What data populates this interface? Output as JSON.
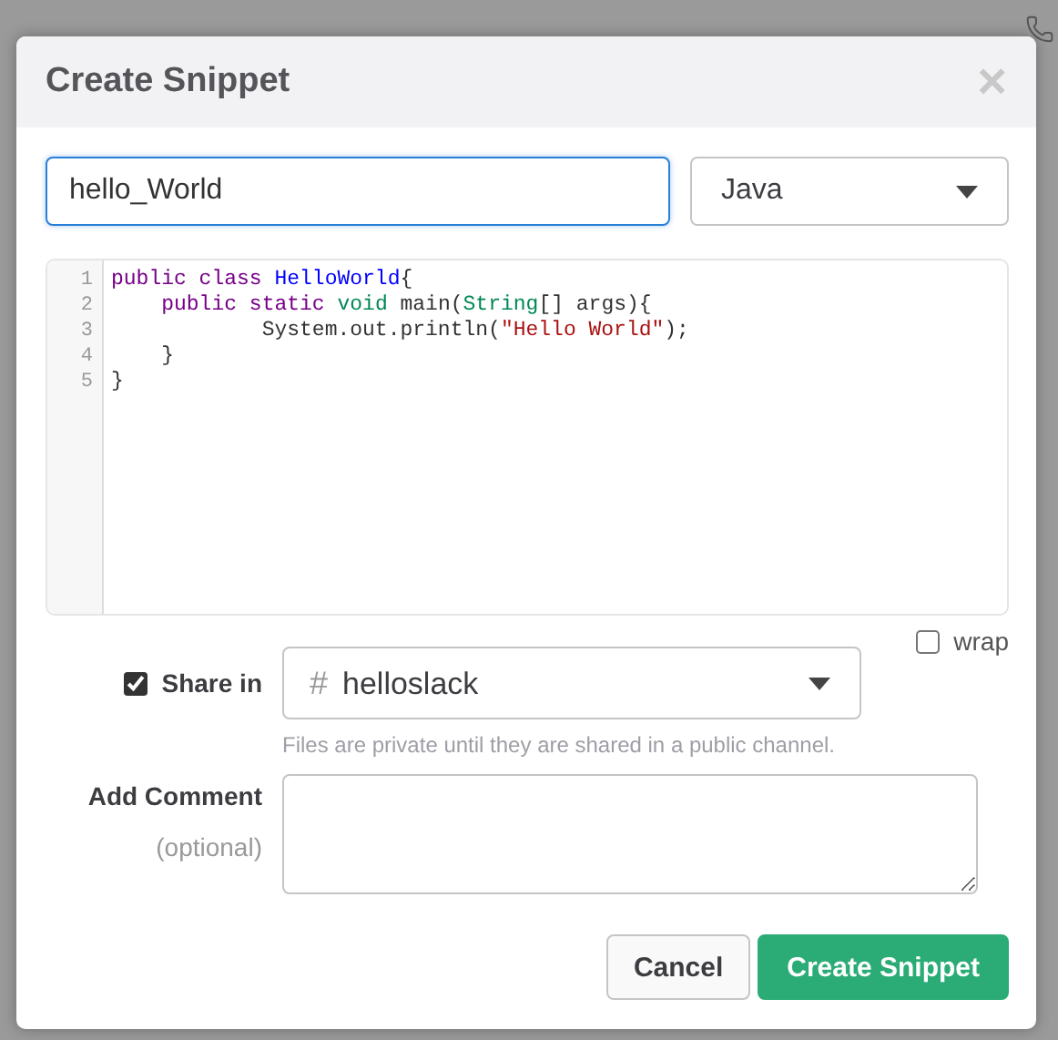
{
  "dialog": {
    "title": "Create Snippet",
    "close": "×"
  },
  "filename": {
    "value": "hello_World"
  },
  "language": {
    "value": "Java"
  },
  "code_lines": [
    {
      "number": "1",
      "tokens": [
        {
          "kind": "keyword",
          "text": "public class "
        },
        {
          "kind": "def",
          "text": "HelloWorld"
        },
        {
          "kind": "plain",
          "text": "{"
        }
      ]
    },
    {
      "number": "2",
      "tokens": [
        {
          "kind": "keyword",
          "text": "    public static "
        },
        {
          "kind": "type",
          "text": "void"
        },
        {
          "kind": "plain",
          "text": " main("
        },
        {
          "kind": "type",
          "text": "String"
        },
        {
          "kind": "plain",
          "text": "[] args){"
        }
      ]
    },
    {
      "number": "3",
      "tokens": [
        {
          "kind": "plain",
          "text": "            System.out.println("
        },
        {
          "kind": "string",
          "text": "\"Hello World\""
        },
        {
          "kind": "plain",
          "text": ");"
        }
      ]
    },
    {
      "number": "4",
      "tokens": [
        {
          "kind": "plain",
          "text": "    }"
        }
      ]
    },
    {
      "number": "5",
      "tokens": [
        {
          "kind": "plain",
          "text": "}"
        }
      ]
    }
  ],
  "wrap": {
    "label": "wrap",
    "checked": false
  },
  "share": {
    "label": "Share in",
    "checked": true,
    "channel_prefix": "#",
    "channel": "helloslack",
    "hint": "Files are private until they are shared in a public channel."
  },
  "comment": {
    "label": "Add Comment",
    "sublabel": "(optional)"
  },
  "buttons": [
    {
      "kind": "secondary",
      "label": "Cancel"
    },
    {
      "kind": "primary",
      "label": "Create Snippet"
    }
  ]
}
